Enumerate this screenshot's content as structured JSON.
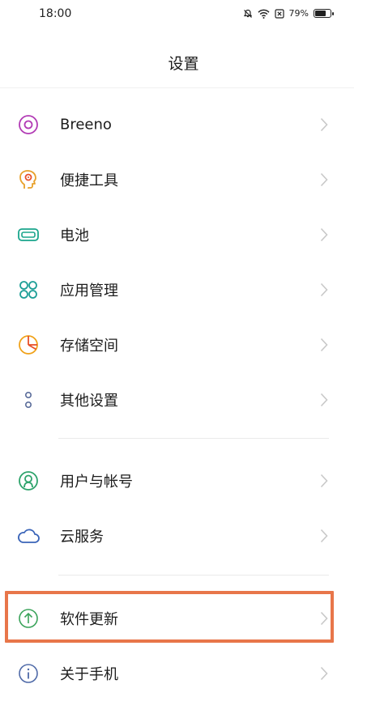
{
  "status_bar": {
    "time": "18:00",
    "battery_percent": "79%",
    "icons": [
      "silent-bell-icon",
      "wifi-icon",
      "sim-x-icon",
      "battery-icon"
    ]
  },
  "header": {
    "title": "设置"
  },
  "settings": {
    "items": [
      {
        "label": "Breeno",
        "icon": "breeno-icon",
        "color": "#b23bb5"
      },
      {
        "label": "便捷工具",
        "icon": "tools-head-icon",
        "color": "#e8a02a"
      },
      {
        "label": "电池",
        "icon": "battery-setting-icon",
        "color": "#1aa58c"
      },
      {
        "label": "应用管理",
        "icon": "apps-grid-icon",
        "color": "#1f9f97"
      },
      {
        "label": "存储空间",
        "icon": "storage-pie-icon",
        "color": "#f0a21a"
      },
      {
        "label": "其他设置",
        "icon": "more-dots-icon",
        "color": "#5a6c9a"
      },
      {
        "label": "用户与帐号",
        "icon": "user-account-icon",
        "color": "#2da36b"
      },
      {
        "label": "云服务",
        "icon": "cloud-icon",
        "color": "#3a64b8"
      },
      {
        "label": "软件更新",
        "icon": "update-arrow-icon",
        "color": "#3aa35a"
      },
      {
        "label": "关于手机",
        "icon": "info-icon",
        "color": "#4f6aa8"
      }
    ]
  },
  "colors": {
    "highlight_border": "#e8764a",
    "chevron": "#c8c8c8"
  }
}
